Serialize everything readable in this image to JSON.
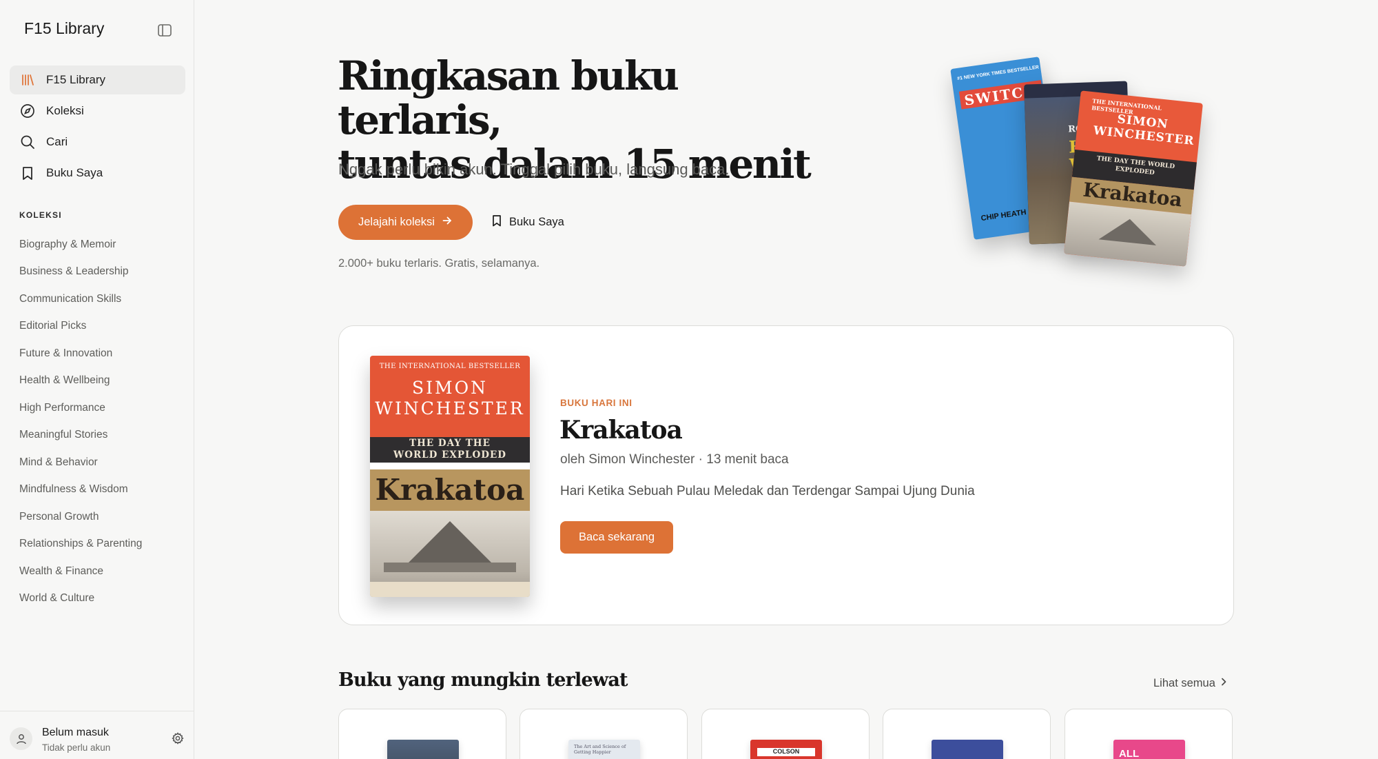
{
  "sidebar": {
    "brand": "F15 Library",
    "nav": [
      {
        "label": "F15 Library",
        "icon": "library-icon",
        "active": true
      },
      {
        "label": "Koleksi",
        "icon": "compass-icon"
      },
      {
        "label": "Cari",
        "icon": "search-icon"
      },
      {
        "label": "Buku Saya",
        "icon": "bookmark-icon"
      }
    ],
    "section_title": "KOLEKSI",
    "categories": [
      "Biography & Memoir",
      "Business & Leadership",
      "Communication Skills",
      "Editorial Picks",
      "Future & Innovation",
      "Health & Wellbeing",
      "High Performance",
      "Meaningful Stories",
      "Mind & Behavior",
      "Mindfulness & Wisdom",
      "Personal Growth",
      "Relationships & Parenting",
      "Wealth & Finance",
      "World & Culture"
    ],
    "user": {
      "name": "Belum masuk",
      "sub": "Tidak perlu akun"
    }
  },
  "hero": {
    "title_line1": "Ringkasan buku terlaris,",
    "title_line2": "tuntas dalam 15 menit",
    "subtitle": "Nggak perlu bikin akun. Tinggal pilih buku, langsung baca.",
    "primary_button": "Jelajahi koleksi",
    "secondary_button": "Buku Saya",
    "note": "2.000+ buku terlaris. Gratis, selamanya."
  },
  "hero_books": [
    {
      "top": "#1 NEW YORK TIMES BESTSELLER",
      "title": "SWITCH",
      "author": "CHIP HEATH",
      "color": "#3a8fd6"
    },
    {
      "title": "HIGH WEB",
      "author": "ROB",
      "color": "#2a2f44"
    },
    {
      "top": "THE INTERNATIONAL BESTSELLER",
      "author": "SIMON WINCHESTER",
      "sub": "THE DAY THE WORLD EXPLODED",
      "title": "Krakatoa",
      "color": "#e8593a"
    }
  ],
  "featured": {
    "eyebrow": "BUKU HARI INI",
    "title": "Krakatoa",
    "meta": "oleh Simon Winchester · 13 menit baca",
    "description": "Hari Ketika Sebuah Pulau Meledak dan Terdengar Sampai Ujung Dunia",
    "button": "Baca sekarang",
    "cover": {
      "top": "THE INTERNATIONAL BESTSELLER",
      "author_line1": "SIMON",
      "author_line2": "WINCHESTER",
      "sub_line1": "THE DAY THE",
      "sub_line2": "WORLD EXPLODED",
      "title": "Krakatoa"
    }
  },
  "missed": {
    "heading": "Buku yang mungkin terlewat",
    "see_all": "Lihat semua",
    "covers": [
      {
        "color": "#4a5e7a"
      },
      {
        "color": "#dfe6ee",
        "label": "The Art and Science of Getting Happier"
      },
      {
        "color": "#d9362c",
        "label": "COLSON"
      },
      {
        "color": "#3c4e9c"
      },
      {
        "color": "#e8488a",
        "label": "ALL"
      }
    ]
  },
  "colors": {
    "accent": "#dd7236",
    "eyebrow": "#d8763c"
  }
}
